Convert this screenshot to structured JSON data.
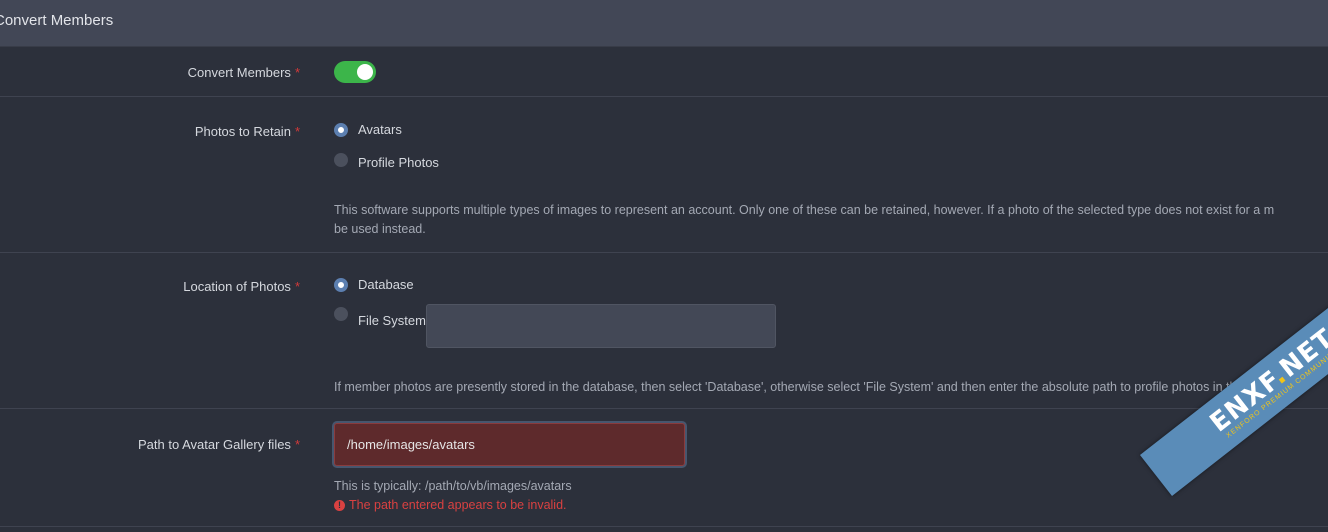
{
  "header": {
    "title": "Convert Members"
  },
  "convert_members": {
    "label": "Convert Members",
    "required": "*",
    "enabled": true
  },
  "photos_to_retain": {
    "label": "Photos to Retain",
    "required": "*",
    "options": [
      "Avatars",
      "Profile Photos"
    ],
    "selected": "Avatars",
    "hint_line1": "This software supports multiple types of images to represent an account. Only one of these can be retained, however. If a photo of the selected type does not exist for a m",
    "hint_line2": "be used instead."
  },
  "location_of_photos": {
    "label": "Location of Photos",
    "required": "*",
    "options": [
      "Database",
      "File System"
    ],
    "selected": "Database",
    "file_system_value": "",
    "hint": "If member photos are presently stored in the database, then select 'Database', otherwise select 'File System' and then enter the absolute path to profile photos in the te"
  },
  "avatar_gallery": {
    "label": "Path to Avatar Gallery files",
    "required": "*",
    "value": "/home/images/avatars",
    "hint": "This is typically: /path/to/vb/images/avatars",
    "error": "The path entered appears to be invalid.",
    "error_icon": "!"
  },
  "watermark": {
    "main": "ENXF",
    "dot": ".",
    "tld": "NET",
    "sub": "XENFORO PREMIUM COMMUNITY"
  },
  "colors": {
    "toggle_on": "#3cb54a",
    "error": "#d94141",
    "radio_accent": "#5c7fb0"
  }
}
